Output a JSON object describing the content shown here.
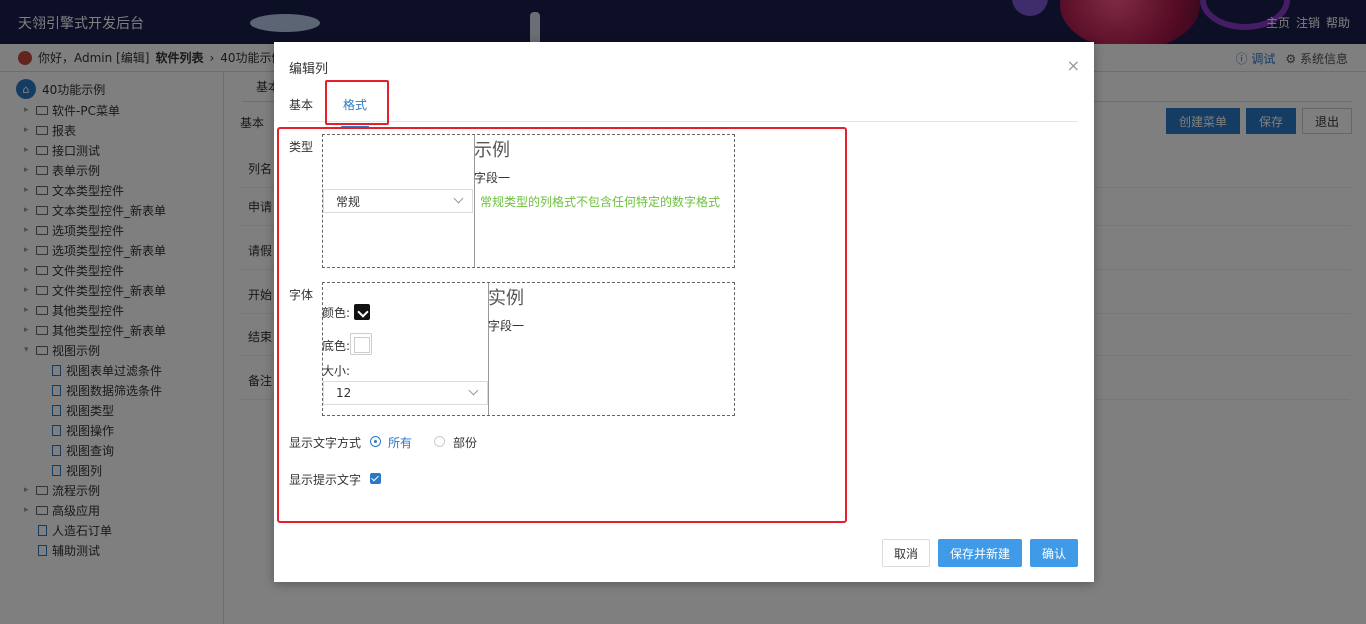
{
  "header": {
    "brand": "天翎引擎式开发后台",
    "nav": [
      "主页",
      "注销",
      "帮助"
    ]
  },
  "breadcrumb": {
    "greeting": "你好，Admin [编辑]",
    "software_list": "软件列表",
    "current": "40功能示例",
    "debug": "ⓘ 调试",
    "system_info": "⚙ 系统信息"
  },
  "sidebar": {
    "root": "40功能示例",
    "items": [
      {
        "label": "软件-PC菜单",
        "kind": "folder"
      },
      {
        "label": "报表",
        "kind": "folder"
      },
      {
        "label": "接口测试",
        "kind": "folder"
      },
      {
        "label": "表单示例",
        "kind": "folder"
      },
      {
        "label": "文本类型控件",
        "kind": "folder"
      },
      {
        "label": "文本类型控件_新表单",
        "kind": "folder"
      },
      {
        "label": "选项类型控件",
        "kind": "folder"
      },
      {
        "label": "选项类型控件_新表单",
        "kind": "folder"
      },
      {
        "label": "文件类型控件",
        "kind": "folder"
      },
      {
        "label": "文件类型控件_新表单",
        "kind": "folder"
      },
      {
        "label": "其他类型控件",
        "kind": "folder"
      },
      {
        "label": "其他类型控件_新表单",
        "kind": "folder"
      },
      {
        "label": "视图示例",
        "kind": "folder-open"
      },
      {
        "label": "视图表单过滤条件",
        "kind": "doc"
      },
      {
        "label": "视图数据筛选条件",
        "kind": "doc"
      },
      {
        "label": "视图类型",
        "kind": "doc"
      },
      {
        "label": "视图操作",
        "kind": "doc"
      },
      {
        "label": "视图查询",
        "kind": "doc"
      },
      {
        "label": "视图列",
        "kind": "doc"
      },
      {
        "label": "流程示例",
        "kind": "folder"
      },
      {
        "label": "高级应用",
        "kind": "folder"
      },
      {
        "label": "人造石订单",
        "kind": "doc-top"
      },
      {
        "label": "辅助测试",
        "kind": "doc-top"
      }
    ]
  },
  "main": {
    "tab": "基本",
    "subtitle": "基本",
    "buttons": [
      "创建菜单",
      "保存",
      "退出"
    ],
    "rows": [
      "列名",
      "申请",
      "请假",
      "开始",
      "结束",
      "备注"
    ]
  },
  "dialog": {
    "title": "编辑列",
    "tabs": {
      "basic": "基本",
      "format": "格式"
    },
    "type_label": "类型",
    "type_value": "常规",
    "example_title": "示例",
    "example_field": "字段一",
    "example_note": "常规类型的列格式不包含任何特定的数字格式",
    "font_label": "字体",
    "color_label": "颜色:",
    "bgcolor_label": "底色:",
    "size_label": "大小:",
    "size_value": "12",
    "sample_title": "实例",
    "sample_field": "字段一",
    "display_mode_label": "显示文字方式",
    "display_all": "所有",
    "display_part": "部份",
    "show_tip_label": "显示提示文字",
    "buttons": {
      "cancel": "取消",
      "save_new": "保存并新建",
      "confirm": "确认"
    }
  }
}
